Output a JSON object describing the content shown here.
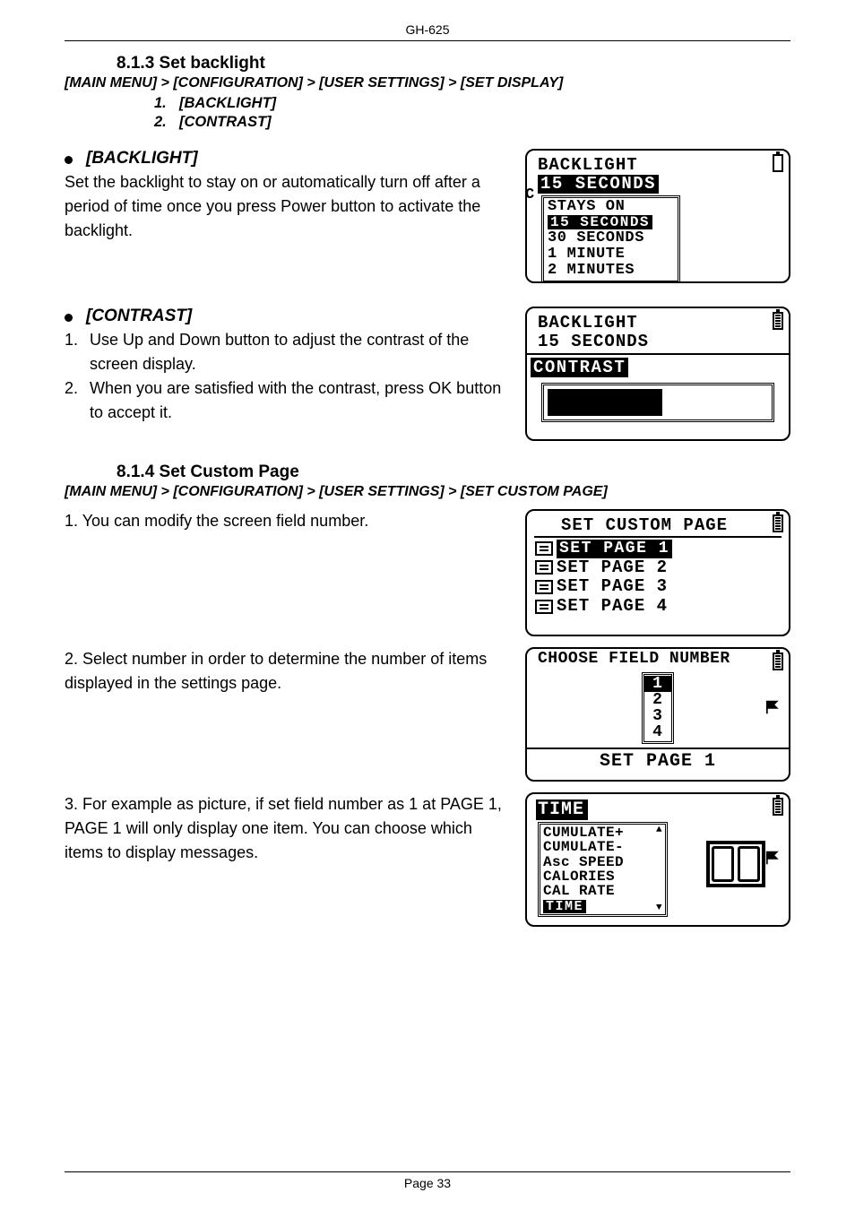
{
  "header": "GH-625",
  "section813": {
    "title": "8.1.3 Set backlight",
    "breadcrumb": "[MAIN MENU] > [CONFIGURATION] > [USER SETTINGS] > [SET DISPLAY]",
    "list": {
      "n1": "1.",
      "i1": "[BACKLIGHT]",
      "n2": "2.",
      "i2": "[CONTRAST]"
    }
  },
  "backlight": {
    "head": "[BACKLIGHT]",
    "body": "Set the backlight to stay on or automatically turn off after a period of time once you press Power button to activate the backlight.",
    "screen": {
      "title": "BACKLIGHT",
      "current": "15 SECONDS",
      "opts": {
        "o1": "STAYS ON",
        "o2": "15 SECONDS",
        "o3": "30 SECONDS",
        "o4": "1 MINUTE",
        "o5": "2 MINUTES"
      }
    }
  },
  "contrast": {
    "head": "[CONTRAST]",
    "l1n": "1.",
    "l1": "Use Up and Down button to adjust the contrast of the screen display.",
    "l2n": "2.",
    "l2": "When you are satisfied with the contrast, press OK button to accept it.",
    "screen": {
      "title": "BACKLIGHT",
      "sub": "15 SECONDS",
      "label": "CONTRAST"
    }
  },
  "section814": {
    "title": "8.1.4 Set Custom Page",
    "breadcrumb": "[MAIN MENU] > [CONFIGURATION] > [USER SETTINGS] > [SET CUSTOM PAGE]"
  },
  "step1": {
    "text": "1. You can modify the screen field number.",
    "screen": {
      "title": "SET CUSTOM PAGE",
      "i1": "SET PAGE 1",
      "i2": "SET PAGE 2",
      "i3": "SET PAGE 3",
      "i4": "SET PAGE 4"
    }
  },
  "step2": {
    "text": "2. Select number in order to determine the number of items displayed in the settings page.",
    "screen": {
      "title": "CHOOSE FIELD NUMBER",
      "n1": "1",
      "n2": "2",
      "n3": "3",
      "n4": "4",
      "footer": "SET PAGE 1"
    }
  },
  "step3": {
    "text": "3. For example as picture, if set field number as 1 at PAGE 1, PAGE 1 will only display one item. You can choose which items to display messages.",
    "screen": {
      "title": "TIME",
      "opts": {
        "o1": "CUMULATE+",
        "o2": "CUMULATE-",
        "o3": "Asc SPEED",
        "o4": "CALORIES",
        "o5": "CAL RATE",
        "o6": "TIME"
      }
    }
  },
  "footer": "Page 33"
}
